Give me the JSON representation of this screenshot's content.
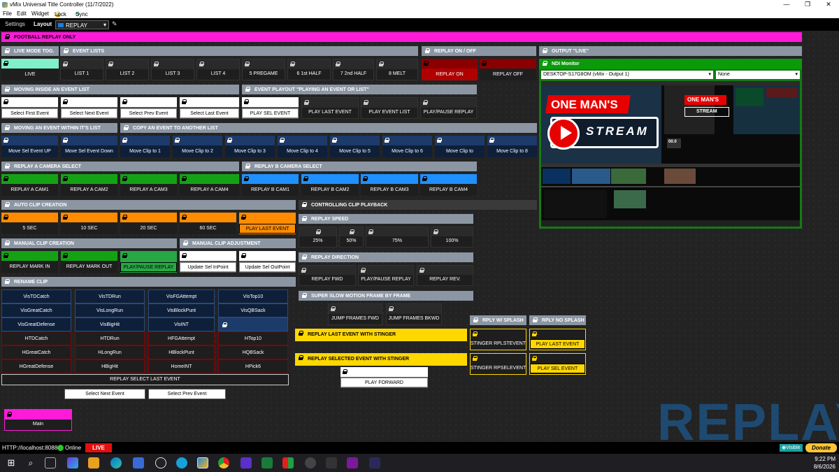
{
  "window": {
    "title": "vMix Universal Title Controller (11/7/2022)",
    "minimize": "—",
    "maximize": "❐",
    "close": "✕"
  },
  "menu": [
    "File",
    "Edit",
    "Widget",
    "Lock",
    "Sync"
  ],
  "toolbar": {
    "settings": "Settings",
    "layout": "Layout",
    "layout_value": "REPLAY",
    "layout_color": "#1e7bdc"
  },
  "headers": {
    "football": "FOOTBALL REPLAY ONLY",
    "live_mode": "LIVE MODE TOG.",
    "event_lists": "EVENT LISTS",
    "replay_onoff": "REPLAY ON / OFF",
    "output_live": "OUTPUT \"LIVE\"",
    "moving_inside": "MOVING INSIDE AN EVENT LIST",
    "event_playout": "EVENT PLAYOUT \"PLAYING AN EVENT OR LIST\"",
    "moving_within": "MOVING AN EVENT WITHIN IT'S LIST",
    "copy_event": "COPY AN EVENT TO ANOTHER LIST",
    "replay_a_cam": "REPLAY A CAMERA SELECT",
    "replay_b_cam": "REPLAY B CAMERA SELECT",
    "auto_clip": "AUTO CLIP CREATION",
    "controlling_clip": "CONTROLLING CLIP PLAYBACK",
    "replay_speed": "REPLAY SPEED",
    "manual_clip": "MANUAL CLIP CREATION",
    "manual_adjust": "MANUAL CLIP ADJUSTMENT",
    "replay_direction": "REPLAY DIRECTION",
    "rename_clip": "RENAME CLIP",
    "super_slow": "SUPER SLOW MOTION FRAME BY FRAME",
    "rply_splash": "RPLY W/ SPLASH",
    "rply_nosplash": "RPLY NO SPLASH",
    "replay_last_stinger": "REPLAY LAST EVENT WITH STINGER",
    "replay_sel_stinger": "REPLAY SELECTED EVENT WITH STINGER"
  },
  "buttons": {
    "live": "LIVE",
    "lists": [
      "LIST 1",
      "LIST 2",
      "LIST 3",
      "LIST 4",
      "5 PREGAME",
      "6 1st HALF",
      "7 2nd HALF",
      "8 MELT"
    ],
    "replay_on": "REPLAY ON",
    "replay_off": "REPLAY OFF",
    "moving_inside": [
      "Select First Event",
      "Select Next Event",
      "Select Prev Event",
      "Select Last Event"
    ],
    "playout": [
      "PLAY SEL EVENT",
      "PLAY LAST EVENT",
      "PLAY EVENT LIST",
      "PLAY/PAUSE REPLAY"
    ],
    "move_event": [
      "Move Sel Event UP",
      "Move Sel Event Down"
    ],
    "copy_event": [
      "Move Clip to 1",
      "Move Clip to 2",
      "Move Clip to 3",
      "Move Clip to 4",
      "Move Clip to 5",
      "Move Clip to 6",
      "Move Clip to",
      "Move Clip to 8"
    ],
    "cam_a": [
      "REPLAY A CAM1",
      "REPLAY A CAM2",
      "REPLAY A CAM3",
      "REPLAY A CAM4"
    ],
    "cam_b": [
      "REPLAY B CAM1",
      "REPLAY B CAM2",
      "REPLAY B CAM3",
      "REPLAY B CAM4"
    ],
    "auto_clip": [
      "5 SEC",
      "10 SEC",
      "20 SEC",
      "60 SEC",
      "PLAY LAST EVENT"
    ],
    "speed": [
      "25%",
      "50%",
      "75%",
      "100%"
    ],
    "manual_clip": [
      "REPLAY MARK IN",
      "REPLAY MARK OUT",
      "PLAY/PAUSE REPLAY"
    ],
    "manual_adjust": [
      "Update Sel InPoint",
      "Update Sel OutPoint"
    ],
    "direction": [
      "REPLAY FWD",
      "PLAY/PAUSE REPLAY",
      "REPLAY REV."
    ],
    "jump": [
      "JUMP FRAMES FWD",
      "JUMP FRAMES BKWD"
    ],
    "splash_last": "STINGER RPLSTEVENT",
    "splash_sel": "STINGER RPSELEVENT",
    "nosplash_last": "PLAY LAST EVENT",
    "nosplash_sel": "PLAY SEL EVENT",
    "play_forward": "PLAY FORWARD",
    "replay_select_last": "REPLAY SELECT LAST EVENT",
    "select_next": "Select Next Event",
    "select_prev": "Select Prev Event",
    "main": "Main"
  },
  "rename": {
    "vis": [
      [
        "VisTDCatch",
        "VisTDRun",
        "VisFGAttempt",
        "VisTop10"
      ],
      [
        "VisGreatCatch",
        "VisLongRun",
        "VisBlockPunt",
        "VisQBSack"
      ],
      [
        "VisGreatDefense",
        "VisBigHit",
        "VisINT",
        ""
      ]
    ],
    "home": [
      [
        "HTDCatch",
        "HTDRun",
        "HFGAttempt",
        "HTop10"
      ],
      [
        "HGreatCatch",
        "HLongRun",
        "HBlockPunt",
        "HQBSack"
      ],
      [
        "HGreatDefense",
        "HBigHit",
        "HomeINT",
        "HPick6"
      ]
    ]
  },
  "ndi": {
    "title": "NDI Monitor",
    "source": "DESKTOP-S17G8OM (vMix - Output 1)",
    "second": "None",
    "preview_text_1": "ONE MAN'S",
    "preview_text_2": "STREAM",
    "preview_small_1": "ONE MAN'S",
    "preview_small_2": "STREAM",
    "preview_timer": "00.0"
  },
  "watermark": "REPLAY",
  "status": {
    "url": "HTTP://localhost:8088",
    "online": "Online",
    "live": "LIVE",
    "visible": "Visible",
    "donate": "Donate"
  },
  "taskbar": {
    "time": "9:22 PM",
    "date": "8/6/2026"
  }
}
